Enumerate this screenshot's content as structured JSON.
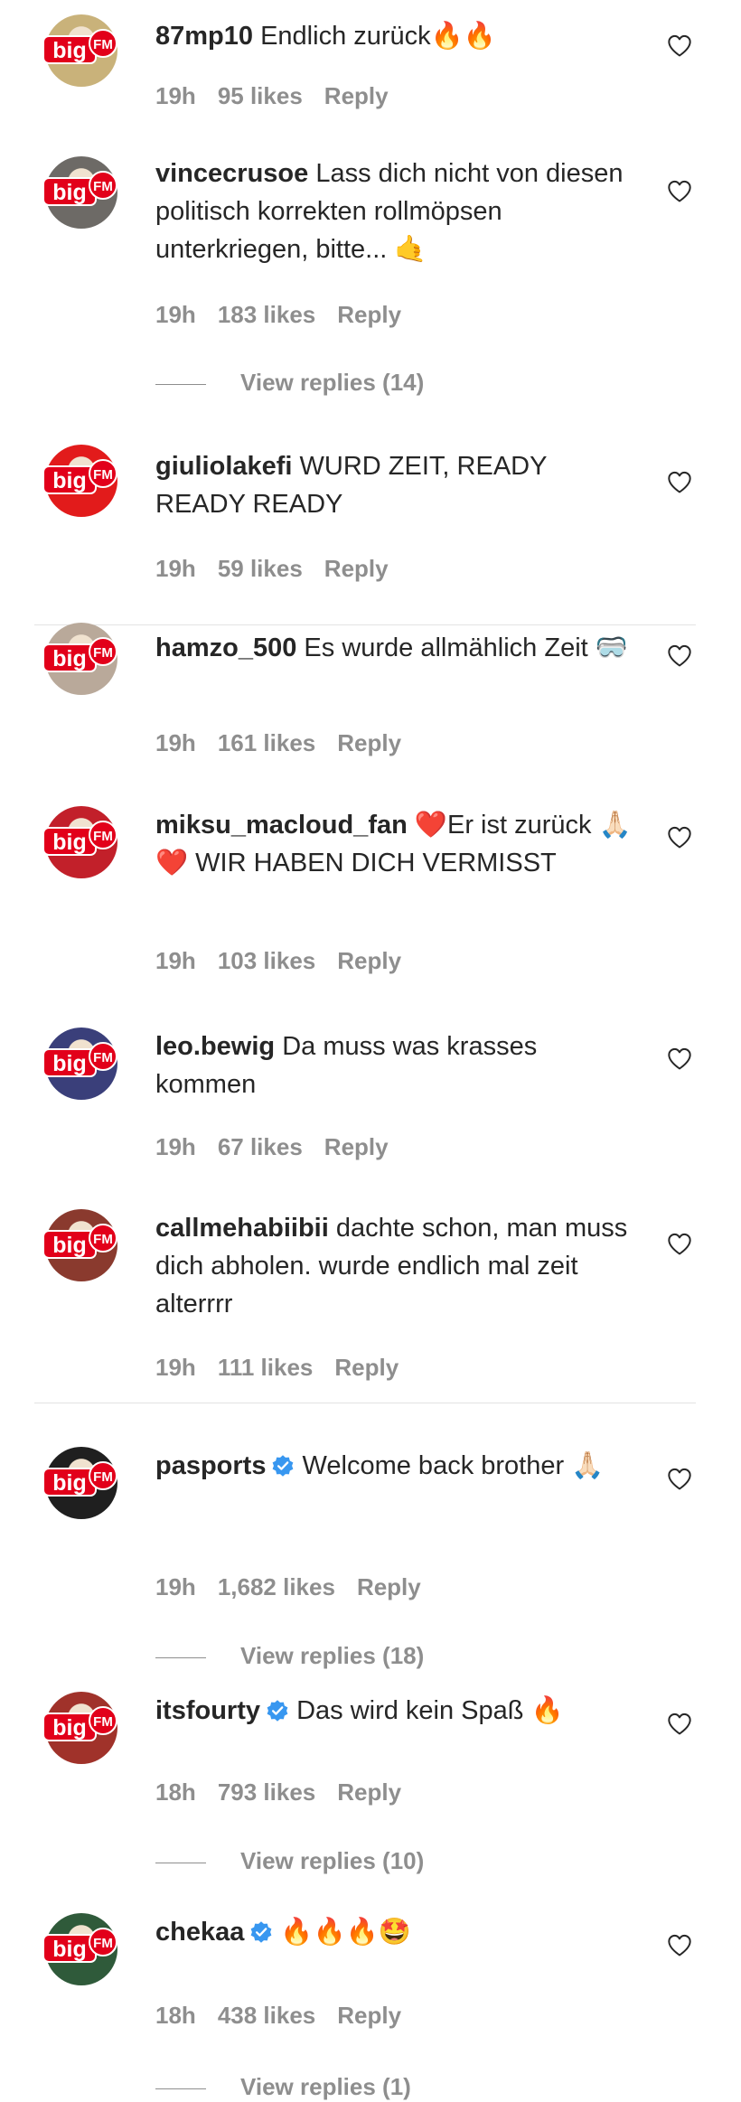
{
  "comments": [
    {
      "username": "87mp10",
      "text": "Endlich zurück🔥🔥",
      "verified": false,
      "time": "19h",
      "likes": "95 likes",
      "reply": "Reply",
      "view_replies": "",
      "avatar_color": "#c9b27a"
    },
    {
      "username": "vincecrusoe",
      "text": "Lass dich nicht von diesen politisch korrekten rollmöpsen unterkriegen, bitte... 🤙",
      "verified": false,
      "time": "19h",
      "likes": "183 likes",
      "reply": "Reply",
      "view_replies": "View replies (14)",
      "avatar_color": "#6d6a66"
    },
    {
      "username": "giuliolakefi",
      "text": "WURD ZEIT, READY READY READY",
      "verified": false,
      "time": "19h",
      "likes": "59 likes",
      "reply": "Reply",
      "view_replies": "",
      "avatar_color": "#e21b1b"
    },
    {
      "username": "hamzo_500",
      "text": "Es wurde allmählich Zeit 🥽",
      "verified": false,
      "time": "19h",
      "likes": "161 likes",
      "reply": "Reply",
      "view_replies": "",
      "avatar_color": "#b9a99a"
    },
    {
      "username": "miksu_macloud_fan",
      "text": "❤️Er ist zurück 🙏🏻❤️ WIR HABEN DICH VERMISST",
      "verified": false,
      "time": "19h",
      "likes": "103 likes",
      "reply": "Reply",
      "view_replies": "",
      "avatar_color": "#c2202a"
    },
    {
      "username": "leo.bewig",
      "text": "Da muss was krasses kommen",
      "verified": false,
      "time": "19h",
      "likes": "67 likes",
      "reply": "Reply",
      "view_replies": "",
      "avatar_color": "#3a3f7a"
    },
    {
      "username": "callmehabiibii",
      "text": "dachte schon, man muss dich abholen. wurde endlich mal zeit alterrrr",
      "verified": false,
      "time": "19h",
      "likes": "111 likes",
      "reply": "Reply",
      "view_replies": "",
      "avatar_color": "#8a3a2e"
    },
    {
      "username": "pasports",
      "text": "Welcome back brother 🙏🏻",
      "verified": true,
      "time": "19h",
      "likes": "1,682 likes",
      "reply": "Reply",
      "view_replies": "View replies (18)",
      "avatar_color": "#1f1f1f"
    },
    {
      "username": "itsfourty",
      "text": "Das wird kein Spaß 🔥",
      "verified": true,
      "time": "18h",
      "likes": "793 likes",
      "reply": "Reply",
      "view_replies": "View replies (10)",
      "avatar_color": "#a0322a"
    },
    {
      "username": "chekaa",
      "text": "🔥🔥🔥🤩",
      "verified": true,
      "time": "18h",
      "likes": "438 likes",
      "reply": "Reply",
      "view_replies": "View replies (1)",
      "avatar_color": "#2f5a3a"
    }
  ],
  "icons": {
    "heart": "heart-outline-icon",
    "verified": "verified-badge-icon",
    "avatar_overlay": "bigfm-logo-icon"
  },
  "logo_text": {
    "big": "big",
    "fm": "FM"
  },
  "colors": {
    "text": "#262626",
    "meta": "#8e8e8e",
    "verified": "#3897f0",
    "bigfm_red": "#e2001a",
    "divider": "#e3e3e3"
  }
}
